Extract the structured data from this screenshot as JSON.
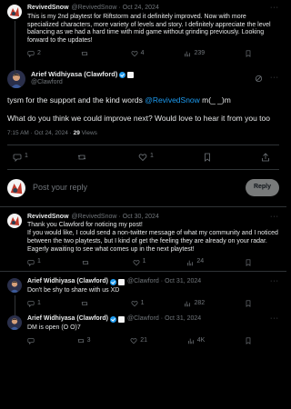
{
  "tweets": [
    {
      "name": "RevivedSnow",
      "handle": "@RevivedSnow",
      "date": "Oct 24, 2024",
      "text": "This is my 2nd playtest for Riftstorm and it definitely improved. Now with more specialized characters, more variety of levels and story. I definitely appreciate the level balancing as we had a hard time with mid game without grinding previously. Looking forward to the updates!",
      "replies": "2",
      "reposts": "",
      "likes": "4",
      "views": "239"
    }
  ],
  "focus": {
    "name": "Arief Widhiyasa (Clawford)",
    "handle": "@Clawford",
    "text_pre": "tysm for the support and the kind words ",
    "mention": "@RevivedSnow",
    "text_post": " m(_ _)m",
    "text2": "What do you think we could improve next? Would love to hear it from you too",
    "time": "7:15 AM · Oct 24, 2024 · ",
    "views_count": "29",
    "views_label": " Views",
    "replies": "1",
    "reposts": "",
    "likes": "1"
  },
  "reply_box": {
    "placeholder": "Post your reply",
    "button": "Reply"
  },
  "replies": [
    {
      "name": "RevivedSnow",
      "handle": "@RevivedSnow",
      "date": "Oct 30, 2024",
      "text": "Thank you Clawford for noticing my post!\nIf you would like, I could send a non-twitter message of what my community and I noticed between the two playtests, but I kind of get the feeling they are already on your radar.\nEagerly awaiting to see what comes up in the next playtest!",
      "replies": "1",
      "reposts": "",
      "likes": "1",
      "views": "24"
    },
    {
      "name": "Arief Widhiyasa (Clawford)",
      "handle": "@Clawford",
      "date": "Oct 31, 2024",
      "text": "Don't be shy to share with us XD",
      "replies": "1",
      "reposts": "",
      "likes": "1",
      "views": "282"
    },
    {
      "name": "Arief Widhiyasa (Clawford)",
      "handle": "@Clawford",
      "date": "Oct 31, 2024",
      "text": "DM is open (O O)7",
      "replies": "",
      "reposts": "3",
      "likes": "21",
      "views": "4K"
    }
  ],
  "colors": {
    "accent": "#1d9bf0",
    "muted": "#71767b",
    "divider": "#2f3336",
    "background": "#000000"
  },
  "icons": [
    "more-icon",
    "reply-icon",
    "repost-icon",
    "like-icon",
    "views-icon",
    "bookmark-icon",
    "share-icon",
    "grok-icon",
    "verified-badge-icon"
  ]
}
